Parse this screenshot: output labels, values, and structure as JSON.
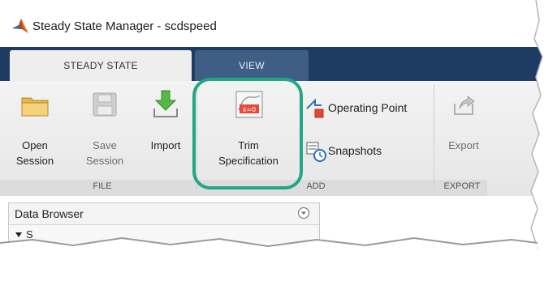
{
  "window": {
    "title": "Steady State Manager - scdspeed"
  },
  "tabs": [
    {
      "label": "STEADY STATE",
      "active": true
    },
    {
      "label": "VIEW",
      "active": false
    }
  ],
  "ribbon": {
    "file": {
      "label": "FILE",
      "open": {
        "line1": "Open",
        "line2": "Session"
      },
      "save": {
        "line1": "Save",
        "line2": "Session"
      },
      "import": {
        "label": "Import"
      }
    },
    "add": {
      "label": "ADD",
      "trim": {
        "line1": "Trim",
        "line2": "Specification",
        "icon_text": "ẋ=0"
      },
      "operating_point": {
        "label": "Operating Point"
      },
      "snapshots": {
        "label": "Snapshots"
      }
    },
    "export": {
      "label": "EXPORT",
      "export_btn": {
        "label": "Export"
      }
    }
  },
  "data_browser": {
    "title": "Data Browser",
    "row_label": "S"
  },
  "colors": {
    "highlight": "#20a783",
    "tab_bar": "#1d3b63",
    "tab_inactive": "#3e5e86"
  }
}
